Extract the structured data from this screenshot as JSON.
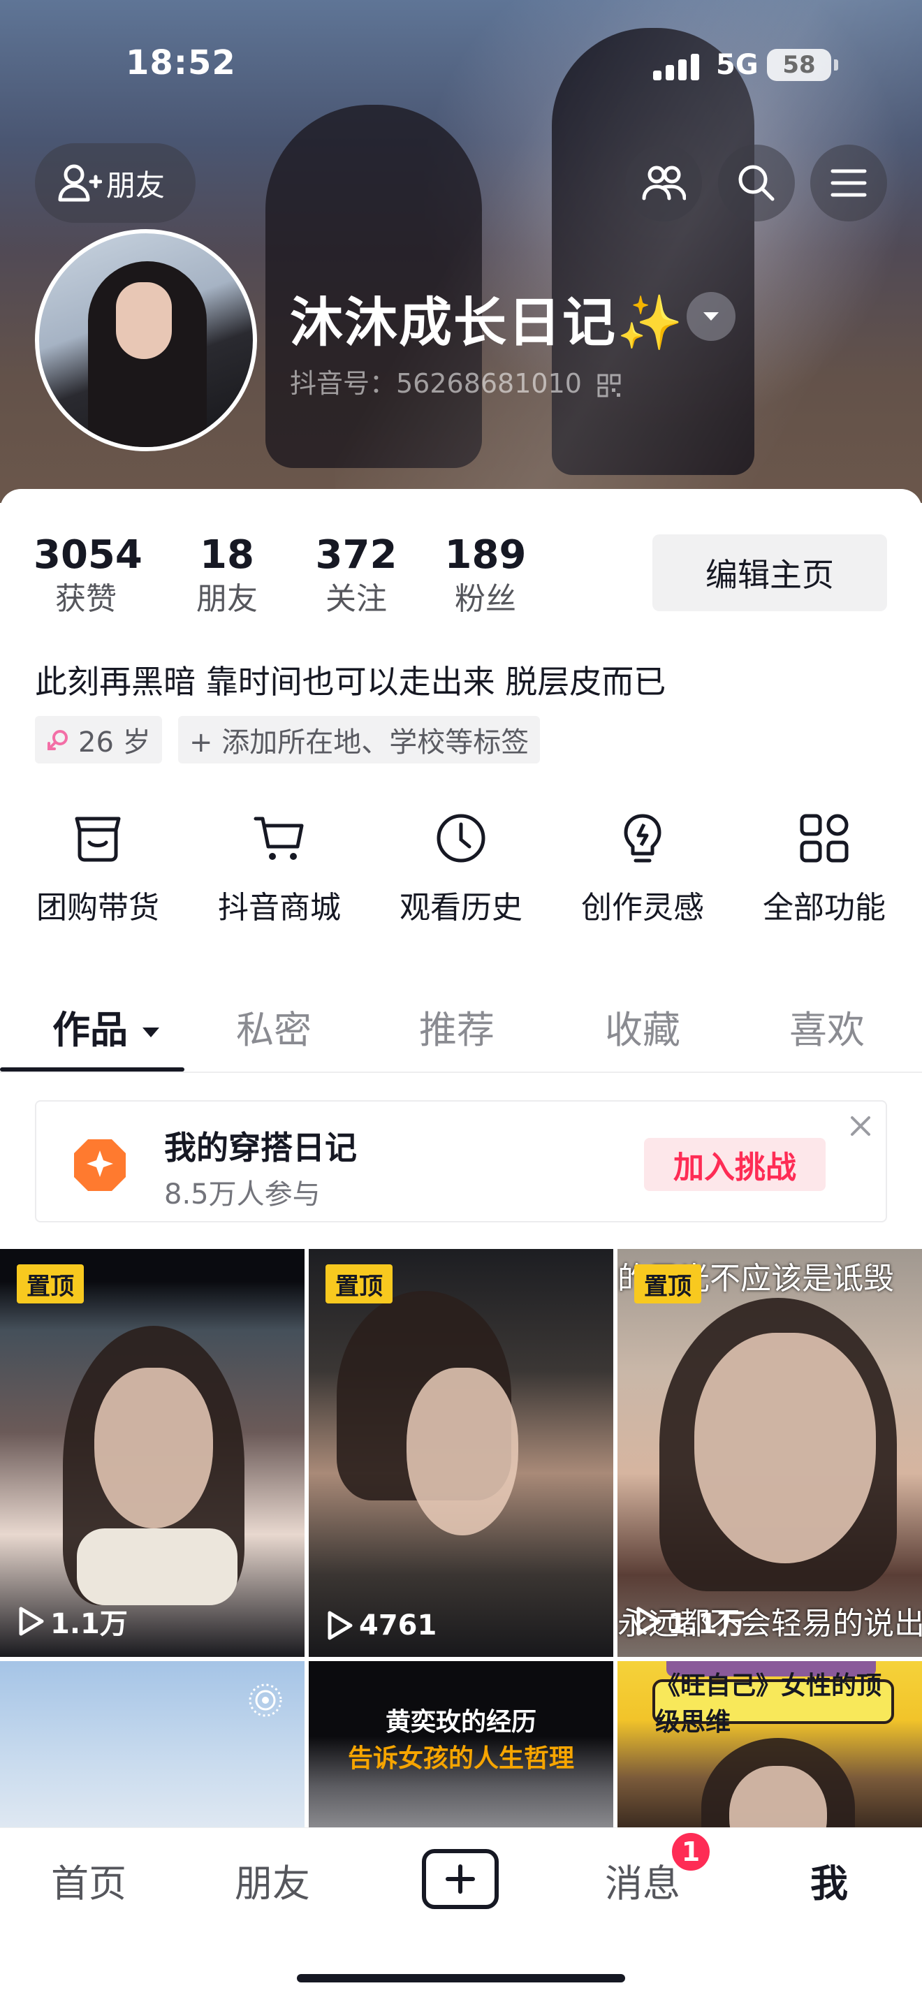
{
  "status_bar": {
    "time": "18:52",
    "network": "5G",
    "battery": "58"
  },
  "header": {
    "friend_button_label": "朋友",
    "username": "沐沐成长日记✨",
    "douyin_id": "抖音号：56268681010"
  },
  "stats": [
    {
      "value": "3054",
      "label": "获赞"
    },
    {
      "value": "18",
      "label": "朋友"
    },
    {
      "value": "372",
      "label": "关注"
    },
    {
      "value": "189",
      "label": "粉丝"
    }
  ],
  "edit_profile_label": "编辑主页",
  "bio": "此刻再黑暗 靠时间也可以走出来 脱层皮而已",
  "tags": {
    "age": "26 岁",
    "add": "+ 添加所在地、学校等标签"
  },
  "tools": [
    {
      "label": "团购带货",
      "icon": "shop-icon"
    },
    {
      "label": "抖音商城",
      "icon": "cart-icon"
    },
    {
      "label": "观看历史",
      "icon": "clock-icon"
    },
    {
      "label": "创作灵感",
      "icon": "bulb-icon"
    },
    {
      "label": "全部功能",
      "icon": "grid-icon"
    }
  ],
  "tabs": [
    {
      "label": "作品",
      "active": true
    },
    {
      "label": "私密"
    },
    {
      "label": "推荐"
    },
    {
      "label": "收藏"
    },
    {
      "label": "喜欢"
    }
  ],
  "challenge": {
    "title": "我的穿搭日记",
    "subtitle": "8.5万人参与",
    "button": "加入挑战"
  },
  "videos": [
    {
      "pinned": "置顶",
      "plays": "1.1万"
    },
    {
      "pinned": "置顶",
      "plays": "4761"
    },
    {
      "pinned": "置顶",
      "plays": "1.1万",
      "overlay_top": "的目光不应该是诋毁",
      "overlay_bottom": "永远都不会轻易的说出"
    },
    {},
    {
      "overlay_line1": "黄奕玫的经历",
      "overlay_line2": "告诉女孩的人生哲理"
    },
    {
      "overlay_banner": "《旺自己》女性的顶级思维"
    }
  ],
  "bottom_nav": {
    "home": "首页",
    "friends": "朋友",
    "messages": "消息",
    "me": "我",
    "messages_badge": "1"
  },
  "colors": {
    "accent": "#fe2c55",
    "pin": "#f8c91f",
    "challenge": "#ff7a2f"
  }
}
